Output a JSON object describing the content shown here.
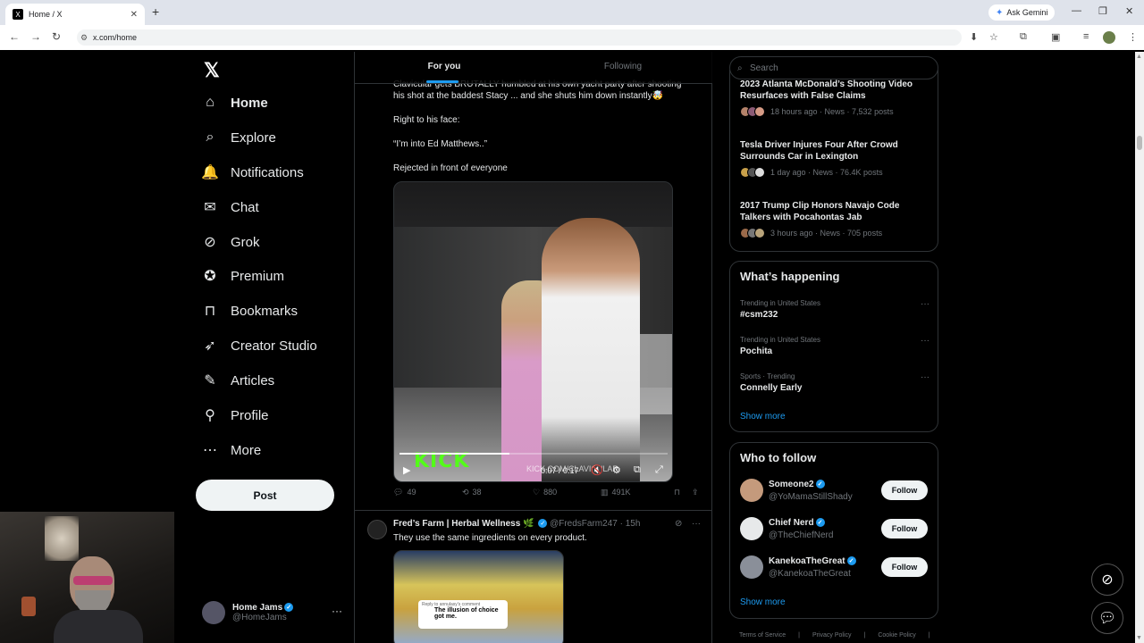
{
  "browser": {
    "tab_title": "Home / X",
    "tab_favicon": "X",
    "new_tab": "+",
    "ask_gemini": "Ask Gemini",
    "url": "x.com/home"
  },
  "nav": {
    "logo": "𝕏",
    "items": [
      {
        "label": "Home",
        "icon": "home-icon",
        "glyph": "⌂",
        "active": true
      },
      {
        "label": "Explore",
        "icon": "search-icon",
        "glyph": "⌕"
      },
      {
        "label": "Notifications",
        "icon": "bell-icon",
        "glyph": "🔔"
      },
      {
        "label": "Chat",
        "icon": "mail-icon",
        "glyph": "✉"
      },
      {
        "label": "Grok",
        "icon": "grok-icon",
        "glyph": "⊘"
      },
      {
        "label": "Premium",
        "icon": "premium-icon",
        "glyph": "✪"
      },
      {
        "label": "Bookmarks",
        "icon": "bookmark-icon",
        "glyph": "⊓"
      },
      {
        "label": "Creator Studio",
        "icon": "rocket-icon",
        "glyph": "➶"
      },
      {
        "label": "Articles",
        "icon": "articles-icon",
        "glyph": "✎"
      },
      {
        "label": "Profile",
        "icon": "profile-icon",
        "glyph": "⚲"
      },
      {
        "label": "More",
        "icon": "more-icon",
        "glyph": "⋯"
      }
    ],
    "post_button": "Post",
    "account": {
      "name": "Home Jams",
      "handle": "@HomeJams"
    }
  },
  "timeline": {
    "tabs": [
      {
        "label": "For you",
        "active": true
      },
      {
        "label": "Following"
      }
    ],
    "tweet1": {
      "line1": "Clavicular gets BRUTALLY humbled at his own yacht party after shooting",
      "line2": "his shot at the baddest Stacy ... and she shuts him down instantly🤯",
      "p2": "Right to his face:",
      "p3": "“I’m into Ed Matthews..”",
      "p4": "Rejected in front of everyone",
      "video": {
        "brand": "KICK",
        "watermark": "KICK.COM/CLAVICULAR",
        "time": "0:07 / 0:17",
        "progress": 0.41
      },
      "replies": "49",
      "reposts": "38",
      "likes": "880",
      "views": "491K"
    },
    "tweet2": {
      "name": "Fred’s Farm | Herbal Wellness 🌿",
      "handle": "@FredsFarm247",
      "time": "· 15h",
      "text": "They use the same ingredients on every product.",
      "bubble_small": "Reply to annulasy's comment",
      "bubble_text": "The illusion of choice got me."
    }
  },
  "sidebar": {
    "search_placeholder": "Search",
    "news": [
      {
        "headline": "2023 Atlanta McDonald’s Shooting Video Resurfaces with False Claims",
        "meta": "18 hours ago · News · 7,532 posts"
      },
      {
        "headline": "Tesla Driver Injures Four After Crowd Surrounds Car in Lexington",
        "meta": "1 day ago · News · 76.4K posts"
      },
      {
        "headline": "2017 Trump Clip Honors Navajo Code Talkers with Pocahontas Jab",
        "meta": "3 hours ago · News · 705 posts"
      }
    ],
    "happening": {
      "title": "What’s happening",
      "trends": [
        {
          "context": "Trending in United States",
          "name": "#csm232"
        },
        {
          "context": "Trending in United States",
          "name": "Pochita"
        },
        {
          "context": "Sports · Trending",
          "name": "Connelly Early"
        }
      ],
      "show_more": "Show more"
    },
    "who_to_follow": {
      "title": "Who to follow",
      "accounts": [
        {
          "name": "Someone2",
          "handle": "@YoMamaStillShady",
          "button": "Follow",
          "color": "#c49a7c"
        },
        {
          "name": "Chief Nerd",
          "handle": "@TheChiefNerd",
          "button": "Follow",
          "color": "#e7e9ea"
        },
        {
          "name": "KanekoaTheGreat",
          "handle": "@KanekoaTheGreat",
          "button": "Follow",
          "color": "#8a8f99"
        }
      ],
      "show_more": "Show more"
    },
    "footer": [
      "Terms of Service",
      "|",
      "Privacy Policy",
      "|",
      "Cookie Policy",
      "|"
    ]
  }
}
